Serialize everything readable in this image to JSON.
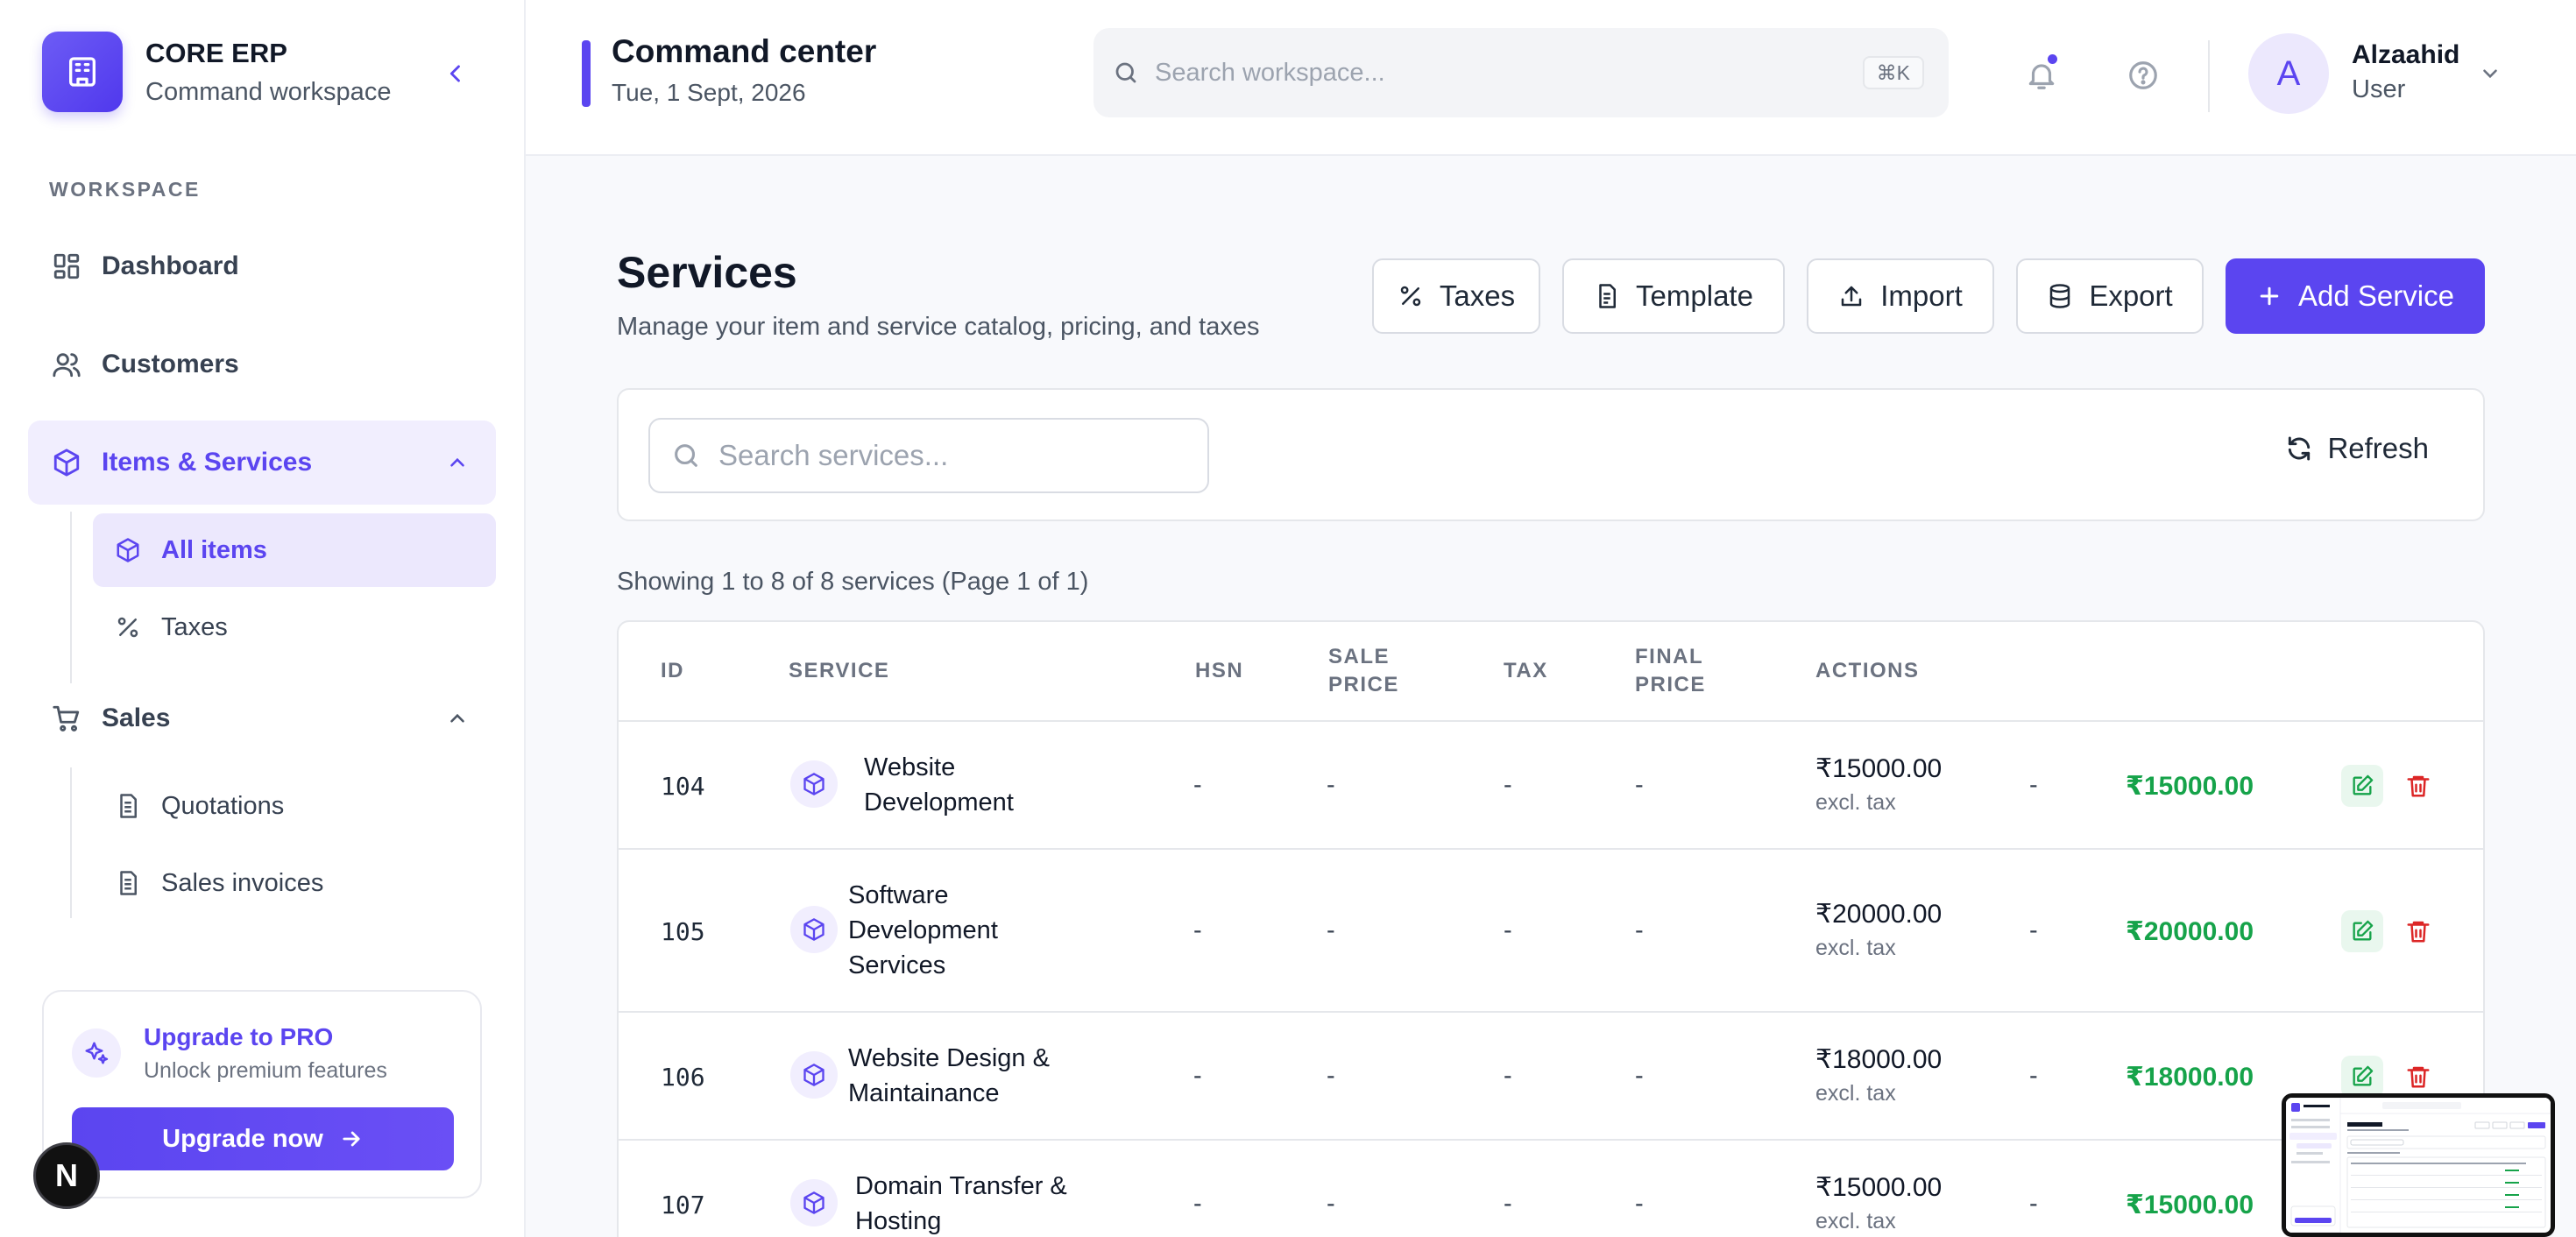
{
  "brand": {
    "title": "CORE ERP",
    "subtitle": "Command workspace"
  },
  "sidebar": {
    "section_label": "WORKSPACE",
    "items": [
      {
        "label": "Dashboard",
        "icon": "dashboard-icon"
      },
      {
        "label": "Customers",
        "icon": "users-icon"
      },
      {
        "label": "Items & Services",
        "icon": "package-icon",
        "expanded": true
      },
      {
        "label": "Sales",
        "icon": "cart-icon",
        "expanded": true
      }
    ],
    "items_sub": [
      {
        "label": "All items",
        "icon": "package-icon",
        "active": true
      },
      {
        "label": "Taxes",
        "icon": "percent-icon"
      }
    ],
    "sales_sub": [
      {
        "label": "Quotations",
        "icon": "document-icon"
      },
      {
        "label": "Sales invoices",
        "icon": "document-icon"
      }
    ],
    "upgrade": {
      "title": "Upgrade to PRO",
      "subtitle": "Unlock premium features",
      "button": "Upgrade now"
    },
    "dev_badge": "N"
  },
  "header": {
    "title": "Command center",
    "date": "Tue, 1 Sept, 2026",
    "search_placeholder": "Search workspace...",
    "shortcut": "⌘K",
    "user_initial": "A",
    "user_name": "Alzaahid",
    "user_role": "User"
  },
  "main": {
    "title": "Services",
    "subtitle": "Manage your item and service catalog, pricing, and taxes",
    "buttons": {
      "taxes": "Taxes",
      "template": "Template",
      "import": "Import",
      "export": "Export",
      "add": "Add Service"
    },
    "search_placeholder": "Search services...",
    "refresh": "Refresh",
    "showing": "Showing 1 to 8 of 8 services (Page 1 of 1)"
  },
  "table": {
    "columns": [
      "ID",
      "SERVICE",
      "HSN",
      "SALE PRICE",
      "TAX",
      "FINAL PRICE",
      "ACTIONS"
    ],
    "rows": [
      {
        "id": "104",
        "service": "Website Development",
        "hsn": "-",
        "sale_price": "-",
        "tax": "-",
        "final_price": "-",
        "price": "₹15000.00",
        "price_note": "excl. tax",
        "tax_amount": "-",
        "final": "₹15000.00"
      },
      {
        "id": "105",
        "service": "Software Development Services",
        "hsn": "-",
        "sale_price": "-",
        "tax": "-",
        "final_price": "-",
        "price": "₹20000.00",
        "price_note": "excl. tax",
        "tax_amount": "-",
        "final": "₹20000.00"
      },
      {
        "id": "106",
        "service": "Website Design & Maintainance",
        "hsn": "-",
        "sale_price": "-",
        "tax": "-",
        "final_price": "-",
        "price": "₹18000.00",
        "price_note": "excl. tax",
        "tax_amount": "-",
        "final": "₹18000.00"
      },
      {
        "id": "107",
        "service": "Domain Transfer & Hosting",
        "hsn": "-",
        "sale_price": "-",
        "tax": "-",
        "final_price": "-",
        "price": "₹15000.00",
        "price_note": "excl. tax",
        "tax_amount": "-",
        "final": "₹15000.00"
      }
    ]
  },
  "colors": {
    "accent": "#5b45f0",
    "success": "#16a34a",
    "danger": "#dc2626"
  }
}
